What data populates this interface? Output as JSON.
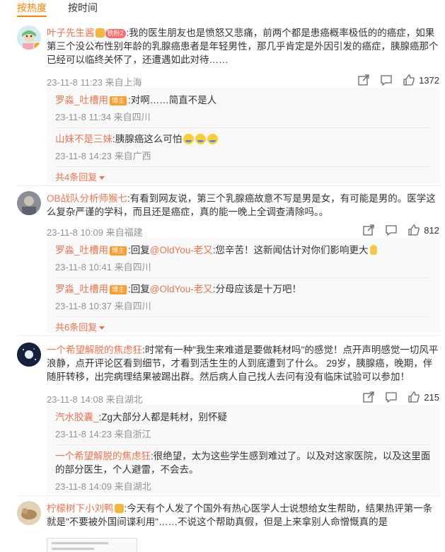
{
  "tabs": [
    {
      "label": "按热度",
      "active": true
    },
    {
      "label": "按时间",
      "active": false
    }
  ],
  "colors": {
    "accent": "#ff8200",
    "username": "#eb7350",
    "meta": "#939393"
  },
  "comments": [
    {
      "user": "叶子先生酱",
      "badge": "铁粉2",
      "text": ":我的医生朋友也是愤怒又悲痛，前两个都是患癌概率极低的的癌症，如果第三个没公布性别年龄的乳腺癌患者是年轻男性，那几乎肯定是外因引发的癌症，胰腺癌那个已经可以临终关怀了，还遭遇如此对待……",
      "meta": "23-11-8 11:23 来自上海",
      "likes": "1372",
      "replies": [
        {
          "user": "罗淼_吐槽用",
          "tag": "博主",
          "text": ":对啊……简直不是人",
          "meta": "23-11-8 11:34 来自四川"
        },
        {
          "user": "山妹不是三妹",
          "text": ":胰腺癌这么可怕",
          "meta": "23-11-8 14:23 来自广西"
        }
      ],
      "more": "共4条回复"
    },
    {
      "user": "OB战队分析师猴七",
      "text": ":有看到网友说，第三个乳腺癌故意不写是男是女，有可能是男的。医学这么复杂严谨的学科，而且还是癌症，真的能一晚上全调查清除吗。。",
      "meta": "23-11-8 10:09 来自福建",
      "likes": "812",
      "replies": [
        {
          "user": "罗淼_吐槽用",
          "tag": "博主",
          "prefix": ":回复",
          "mention": "@OldYou-老又",
          "text": ":您辛苦！这新闻估计对你们影响更大",
          "meta": "23-11-8 10:41 来自四川"
        },
        {
          "user": "罗淼_吐槽用",
          "tag": "博主",
          "prefix": ":回复",
          "mention": "@OldYou-老又",
          "text": ":分母应该是十万吧！",
          "meta": "23-11-8 10:37 来自四川"
        }
      ],
      "more": "共6条回复"
    },
    {
      "user": "一个希望解脱的焦虑狂",
      "text": ":时常有一种\"我生来难道是要做耗材吗\"的感觉！点开声明感觉一切风平浪静，点开评论区看到细节，才看到活生生的人到底遭到了什么。 29岁，胰腺癌，晚期，伴随肝转移，出完病理结果被踢出群。然后病人自己找人去问有没有临床试验可以参加！",
      "meta": "23-11-8 14:08 来自湖北",
      "likes": "215",
      "replies": [
        {
          "user": "汽水胶囊_",
          "text": ":Zg大部分人都是耗材，别怀疑",
          "meta": "23-11-8 14:23 来自浙江"
        },
        {
          "user": "一个希望解脱的焦虑狂",
          "text": ":很绝望，太为这些学生感到难过了。以及对这家医院，以及这里面的部分医生，个人避雷，不会去。",
          "meta": "23-11-8 14:09 来自湖北"
        }
      ]
    },
    {
      "user": "柠檬树下小刘鸭",
      "text": ":今天有个人发了个国外有热心医学人士说想给女生帮助，结果热评第一条就是\"不要被外国间谍利用\"……不说这个帮助真假，但是上来拿别人命憎慨真的是"
    }
  ]
}
